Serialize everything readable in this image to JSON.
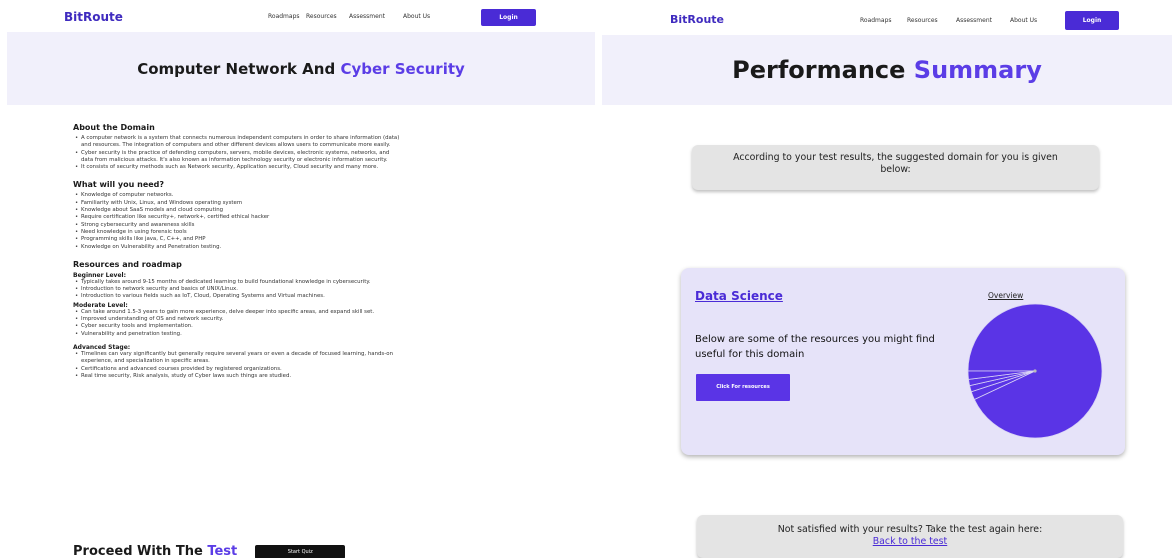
{
  "left": {
    "logo": "BitRoute",
    "nav": [
      "Roadmaps",
      "Resources",
      "Assessment",
      "About Us"
    ],
    "login": "Login",
    "hero_title_main": "Computer Network And",
    "hero_title_accent": "Cyber Security",
    "about_heading": "About the Domain",
    "about_items": [
      "A computer network is a system that connects numerous independent computers in order to share information (data) and resources. The integration of computers and other different devices allows users to communicate more easily.",
      "Cyber security is the practice of defending computers, servers, mobile devices, electronic systems, networks, and data from malicious attacks. It's also known as information technology security or electronic information security.",
      "It consists of security methods such as Network security, Application security, Cloud security and many more."
    ],
    "need_heading": "What will you need?",
    "need_items": [
      "Knowledge of computer networks.",
      "Familiarity with Unix, Linux, and Windows operating system",
      "Knowledge about SaaS models and cloud computing",
      "Require certification like security+, network+, certified ethical hacker",
      "Strong cybersecurity and awareness skills",
      "Need knowledge in using forensic tools",
      "Programming skills like java, C, C++, and PHP",
      "Knowledge on Vulnerability and Penetration testing."
    ],
    "roadmap_heading": "Resources and roadmap",
    "beginner_heading": "Beginner Level:",
    "beginner_items": [
      "Typically takes around 9-15 months of dedicated learning to build foundational knowledge in cybersecurity.",
      "Introduction to network security and basics of UNIX/Linux.",
      "Introduction to various fields such as IoT, Cloud, Operating Systems and Virtual machines."
    ],
    "moderate_heading": "Moderate Level:",
    "moderate_items": [
      "Can take around 1.5-3 years to gain more experience, delve deeper into specific areas, and expand skill set.",
      "Improved understanding of OS and network security.",
      "Cyber security tools and implementation.",
      "Vulnerability and penetration testing."
    ],
    "advanced_heading": "Advanced Stage:",
    "advanced_items": [
      "Timelines can vary significantly but generally require several years or even a decade of focused learning, hands-on experience, and specialization in specific areas.",
      "Certifications and advanced courses provided by registered organizations.",
      "Real time security, Risk analysis, study of Cyber laws such things are studied."
    ],
    "proceed_main": "Proceed With The",
    "proceed_accent": "Test",
    "start_button": "Start Quiz"
  },
  "right": {
    "logo": "BitRoute",
    "nav": [
      "Roadmaps",
      "Resources",
      "Assessment",
      "About Us"
    ],
    "login": "Login",
    "hero_title_main": "Performance",
    "hero_title_accent": "Summary",
    "suggest_text": "According to your test results, the suggested domain for you is given below:",
    "domain_title": "Data Science",
    "overview_label": "Overview",
    "resources_text": "Below are some of the resources you might find useful for this domain",
    "resources_button": "Click For resources",
    "again_text": "Not satisfied with your results? Take the test again here:",
    "again_link": "Back to the test"
  },
  "colors": {
    "brand": "#3f2bbf",
    "accent": "#5b3de6",
    "button": "#4a2bd6",
    "hero_bg": "#f1f0fb",
    "card_bg": "#e6e3f9",
    "pie": "#5a34e6"
  },
  "chart_data": {
    "type": "pie",
    "labels": [],
    "values": [
      93,
      2,
      1.5,
      1.5,
      2
    ]
  }
}
